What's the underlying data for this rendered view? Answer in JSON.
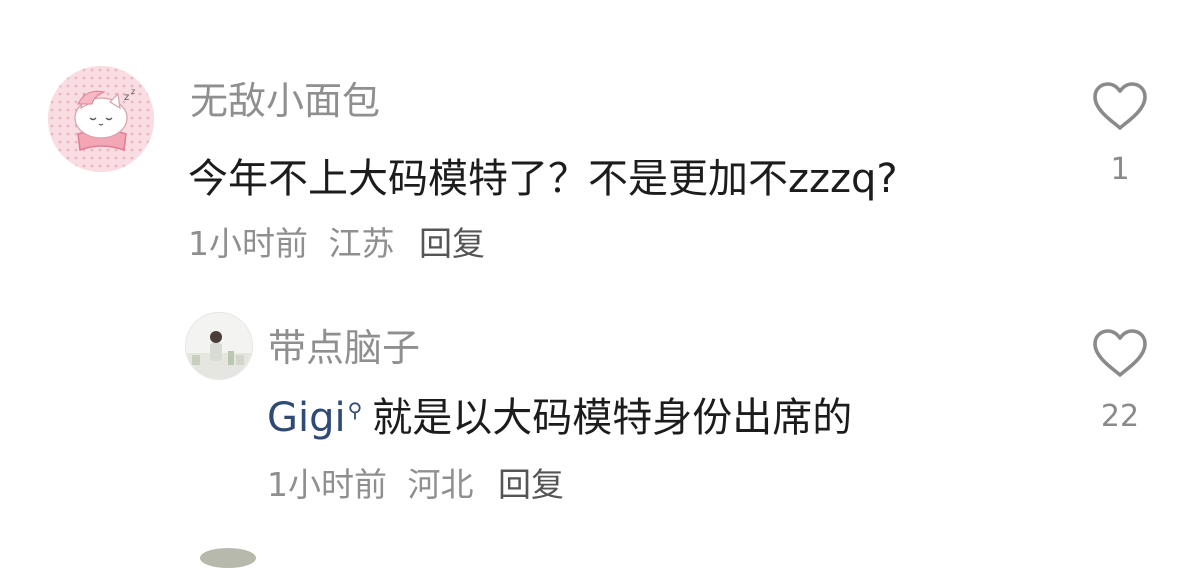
{
  "comments": [
    {
      "username": "无敌小面包",
      "content": "今年不上大码模特了？不是更加不zzzq?",
      "time": "1小时前",
      "location": "江苏",
      "reply_label": "回复",
      "likes": "1",
      "avatar_icon": "cat-sticker-avatar"
    },
    {
      "username": "带点脑子",
      "mention": "Gigi",
      "content": "就是以大码模特身份出席的",
      "time": "1小时前",
      "location": "河北",
      "reply_label": "回复",
      "likes": "22",
      "avatar_icon": "photo-avatar"
    }
  ],
  "colors": {
    "username": "#8f8f8f",
    "content": "#1c1c1c",
    "mention": "#2f4a74",
    "like_icon": "#8a8a8a"
  }
}
